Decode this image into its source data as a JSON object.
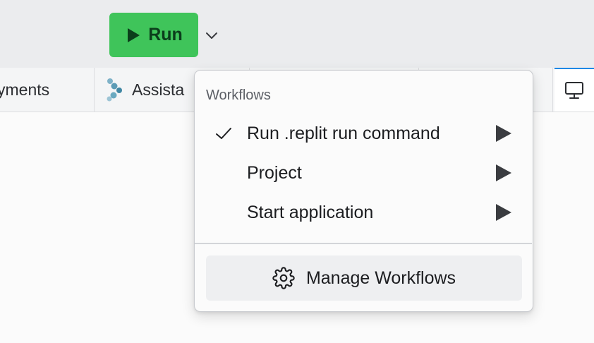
{
  "toolbar": {
    "run_label": "Run",
    "run_button_color": "#3fc45a"
  },
  "tabs": {
    "deployments_label": "yments",
    "assistant_label": "Assista",
    "active_tab_icon": "monitor-icon",
    "active_tab_accent": "#1e88e5"
  },
  "workflows_menu": {
    "heading": "Workflows",
    "items": [
      {
        "label": "Run .replit run command",
        "selected": true
      },
      {
        "label": "Project",
        "selected": false
      },
      {
        "label": "Start application",
        "selected": false
      }
    ],
    "manage_label": "Manage Workflows",
    "manage_icon": "gear-icon"
  }
}
